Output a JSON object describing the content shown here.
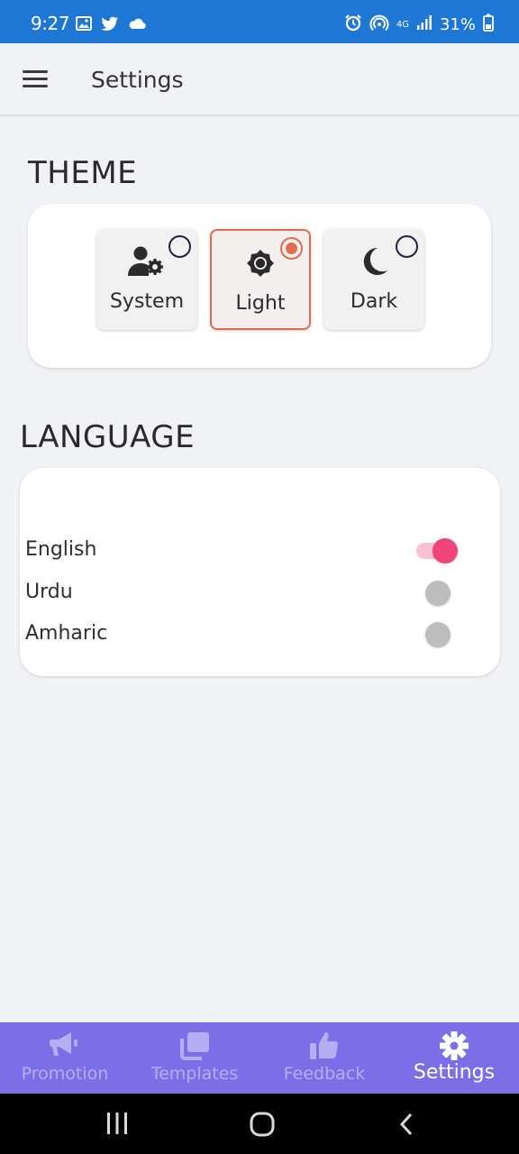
{
  "status_bar": {
    "time": "9:27",
    "battery": "31%",
    "network": "4G",
    "left_icons": [
      "image-icon",
      "twitter-icon",
      "cloud-icon"
    ],
    "right_icons": [
      "alarm-icon",
      "hotspot-icon",
      "signal-icon",
      "battery-icon"
    ]
  },
  "app_bar": {
    "title": "Settings",
    "menu_icon": "menu-icon"
  },
  "theme": {
    "heading": "THEME",
    "options": [
      {
        "label": "System",
        "icon": "user-gear-icon",
        "selected": false
      },
      {
        "label": "Light",
        "icon": "sun-icon",
        "selected": true
      },
      {
        "label": "Dark",
        "icon": "moon-icon",
        "selected": false
      }
    ],
    "accent_color": "#e06d4f"
  },
  "language": {
    "heading": "LANGUAGE",
    "items": [
      {
        "label": "English",
        "enabled": true
      },
      {
        "label": "Urdu",
        "enabled": false
      },
      {
        "label": "Amharic",
        "enabled": false
      }
    ],
    "toggle_on_color": "#f0447a",
    "toggle_off_color": "#bdbdbd"
  },
  "bottom_nav": {
    "background": "#7b6ee6",
    "items": [
      {
        "label": "Promotion",
        "icon": "megaphone-icon",
        "active": false
      },
      {
        "label": "Templates",
        "icon": "templates-icon",
        "active": false
      },
      {
        "label": "Feedback",
        "icon": "thumbs-up-icon",
        "active": false
      },
      {
        "label": "Settings",
        "icon": "gear-icon",
        "active": true
      }
    ]
  },
  "system_nav": {
    "buttons": [
      "recents-button",
      "home-button",
      "back-button"
    ]
  }
}
